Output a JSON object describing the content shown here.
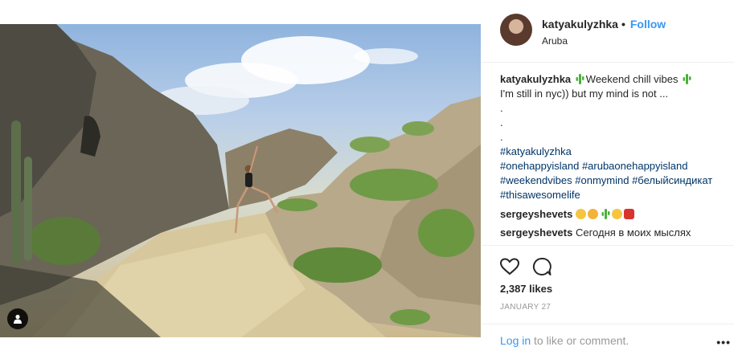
{
  "post": {
    "username": "katyakulyzhka",
    "location": "Aruba",
    "follow_label": "Follow",
    "caption": {
      "username": "katyakulyzhka",
      "text_1": "Weekend chill vibes",
      "text_2": "I'm still in nyc)) but my mind is not ...",
      "dots": [
        ".",
        ".",
        "."
      ],
      "hashtags": [
        "#katyakulyzhka",
        "#onehappyisland",
        "#arubaonehappyisland",
        "#weekendvibes",
        "#onmymind",
        "#белыйсиндикат",
        "#thisawesomelife"
      ]
    },
    "comments": [
      {
        "username": "sergeyshevets",
        "text": ""
      },
      {
        "username": "sergeyshevets",
        "text": "Сегодня в моих мыслях"
      }
    ],
    "likes": "2,387 likes",
    "date": "JANUARY 27"
  },
  "footer": {
    "login_link": "Log in",
    "login_rest": "to like or comment.",
    "more": "•••"
  },
  "colors": {
    "link": "#3897f0",
    "hashtag": "#003569",
    "muted": "#999999"
  }
}
